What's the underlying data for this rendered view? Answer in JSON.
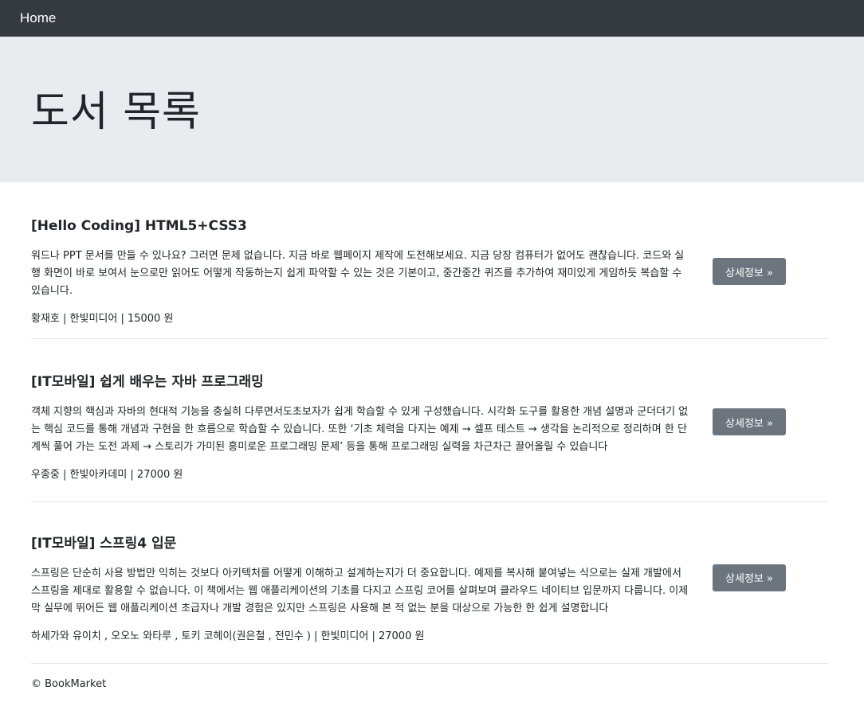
{
  "navbar": {
    "brand": "Home"
  },
  "jumbotron": {
    "title": "도서 목록"
  },
  "books": [
    {
      "title": "[Hello Coding] HTML5+CSS3",
      "description": "워드나 PPT 문서를 만들 수 있나요? 그러면 문제 없습니다. 지금 바로 웹페이지 제작에 도전해보세요. 지금 당장 컴퓨터가 없어도 괜찮습니다. 코드와 실행 화면이 바로 보여서 눈으로만 읽어도 어떻게 작동하는지 쉽게 파악할 수 있는 것은 기본이고, 중간중간 퀴즈를 추가하여 재미있게 게임하듯 복습할 수 있습니다.",
      "meta": "황재호 | 한빛미디어 | 15000 원",
      "button_label": "상세정보 »"
    },
    {
      "title": "[IT모바일] 쉽게 배우는 자바 프로그래밍",
      "description": "객체 지향의 핵심과 자바의 현대적 기능을 충실히 다루면서도초보자가 쉽게 학습할 수 있게 구성했습니다. 시각화 도구를 활용한 개념 설명과 군더더기 없는 핵심 코드를 통해 개념과 구현을 한 흐름으로 학습할 수 있습니다. 또한 ‘기초 체력을 다지는 예제 → 셀프 테스트 → 생각을 논리적으로 정리하며 한 단계씩 풀어 가는 도전 과제 → 스토리가 가미된 흥미로운 프로그래밍 문제’ 등을 통해 프로그래밍 실력을 차근차근 끌어올릴 수 있습니다",
      "meta": "우종중 | 한빛아카데미 | 27000 원",
      "button_label": "상세정보 »"
    },
    {
      "title": "[IT모바일] 스프링4 입문",
      "description": "스프링은 단순히 사용 방법만 익히는 것보다 아키텍처를 어떻게 이해하고 설계하는지가 더 중요합니다. 예제를 복사해 붙여넣는 식으로는 실제 개발에서 스프링을 제대로 활용할 수 없습니다. 이 책에서는 웹 애플리케이션의 기초를 다지고 스프링 코어를 살펴보며 클라우드 네이티브 입문까지 다룹니다. 이제 막 실무에 뛰어든 웹 애플리케이션 초급자나 개발 경험은 있지만 스프링은 사용해 본 적 없는 분을 대상으로 가능한 한 쉽게 설명합니다",
      "meta": "하세가와 유이치 , 오오노 와타루 , 토키 코헤이(권은철 , 전민수 ) | 한빛미디어 | 27000 원",
      "button_label": "상세정보 »"
    }
  ],
  "footer": {
    "text": "© BookMarket"
  }
}
